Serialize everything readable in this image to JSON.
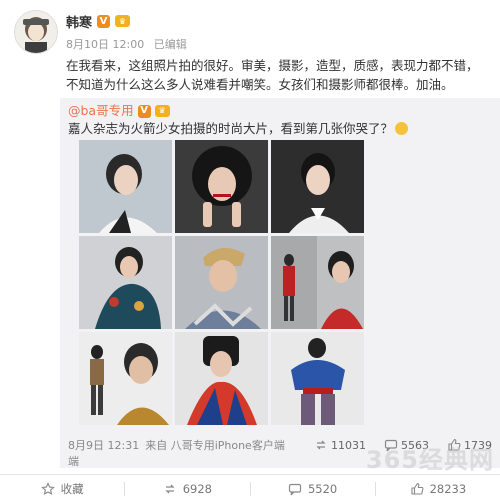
{
  "author": {
    "name": "韩寒",
    "badge": "V",
    "member": "♛"
  },
  "meta": {
    "time": "8月10日 12:00",
    "edit": "已编辑"
  },
  "post_text": "在我看来，这组照片拍的很好。审美，摄影，造型，质感，表现力都不错，不知道为什么这么多人说难看并嘲笑。女孩们和摄影师都很棒。加油。",
  "repost": {
    "author": "@ba哥专用",
    "badge": "V",
    "text": "嘉人杂志为火箭少女拍摄的时尚大片，看到第几张你哭了？",
    "footer": {
      "time": "8月9日 12:31",
      "source": "来自 八哥专用iPhone客户端",
      "tail": "端"
    },
    "stats": {
      "reposts": "11031",
      "comments": "5563",
      "likes": "1739"
    }
  },
  "actions": {
    "favorite": "收藏",
    "repost_count": "6928",
    "comment_count": "5520",
    "like_count": "28233"
  },
  "watermark": "365经典网",
  "colors": {
    "link": "#eb7350",
    "repost_bg": "#f2f2f5",
    "badge": "#f08c1c"
  }
}
